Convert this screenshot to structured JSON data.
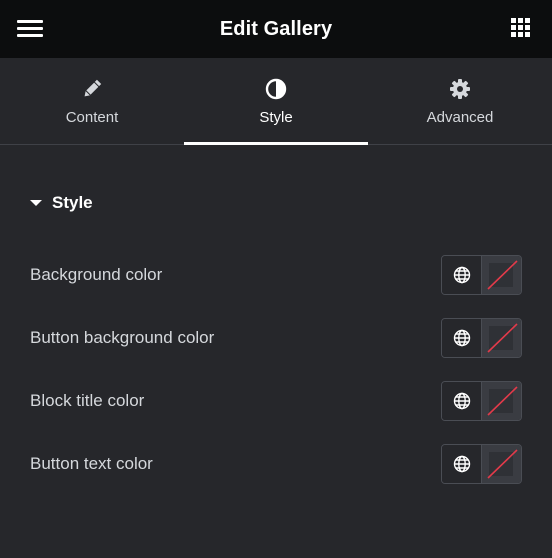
{
  "header": {
    "title": "Edit Gallery"
  },
  "tabs": [
    {
      "label": "Content",
      "icon": "pencil-icon",
      "active": false
    },
    {
      "label": "Style",
      "icon": "half-circle-icon",
      "active": true
    },
    {
      "label": "Advanced",
      "icon": "gear-icon",
      "active": false
    }
  ],
  "section": {
    "title": "Style",
    "expanded": true
  },
  "controls": [
    {
      "label": "Background color"
    },
    {
      "label": "Button background color"
    },
    {
      "label": "Block title color"
    },
    {
      "label": "Button text color"
    }
  ],
  "colors": {
    "header_bg": "#0c0d0e",
    "panel_bg": "#26272b",
    "swatch_bg": "#3a3c42",
    "unset_slash": "#e23a4a"
  }
}
